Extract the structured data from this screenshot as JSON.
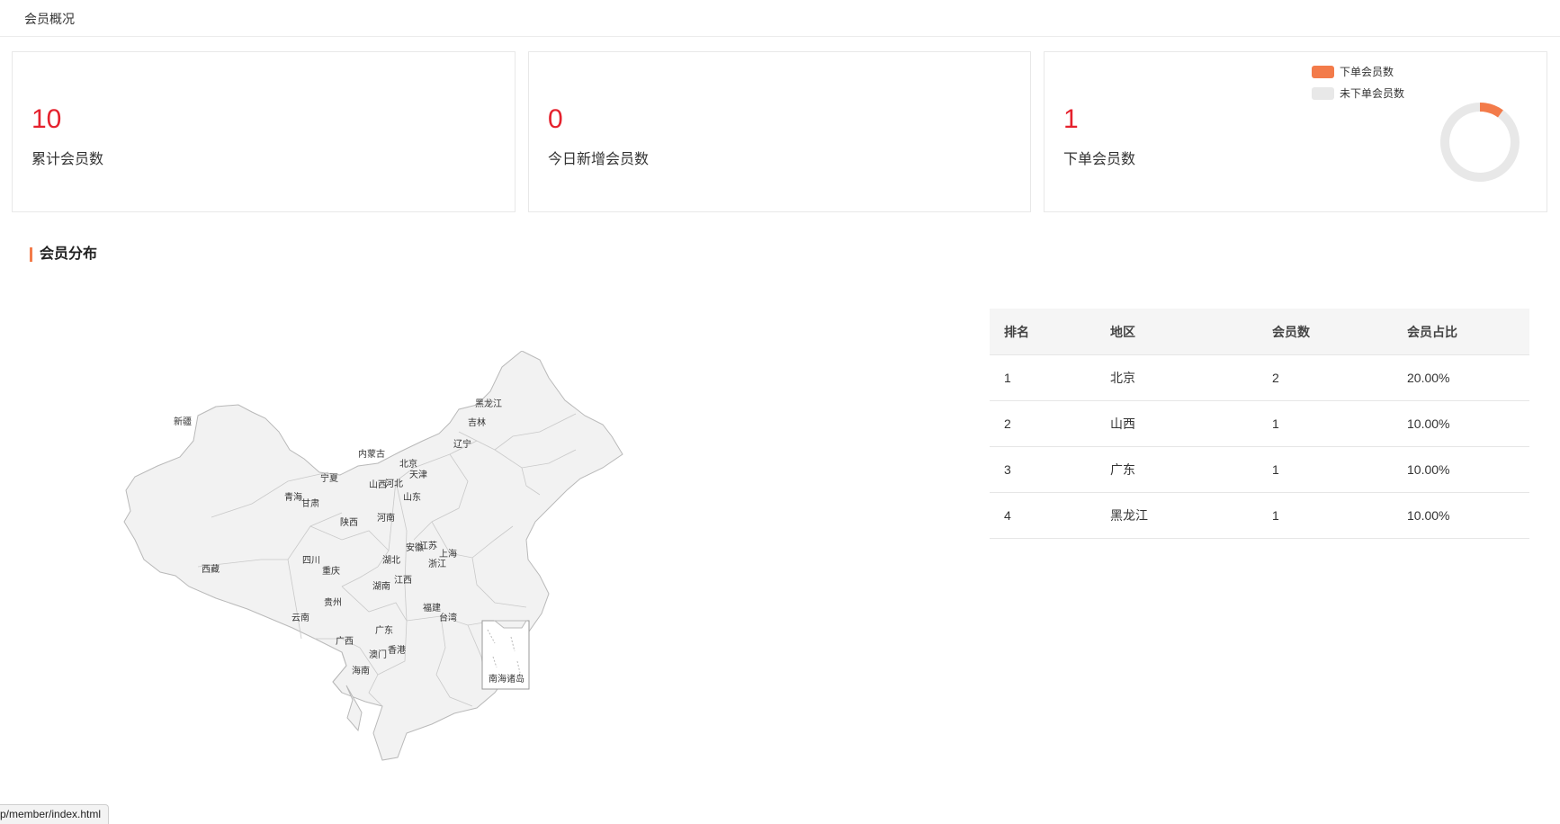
{
  "header": {
    "title": "会员概况"
  },
  "cards": [
    {
      "value": "10",
      "label": "累计会员数"
    },
    {
      "value": "0",
      "label": "今日新增会员数"
    },
    {
      "value": "1",
      "label": "下单会员数"
    }
  ],
  "legend": {
    "ordered": {
      "label": "下单会员数",
      "color": "#f37b4a"
    },
    "not_ordered": {
      "label": "未下单会员数",
      "color": "#e8e8e8"
    }
  },
  "section": {
    "title": "会员分布"
  },
  "map": {
    "provinces": [
      "新疆",
      "西藏",
      "青海",
      "甘肃",
      "宁夏",
      "内蒙古",
      "黑龙江",
      "吉林",
      "辽宁",
      "北京",
      "天津",
      "河北",
      "山西",
      "山东",
      "陕西",
      "河南",
      "江苏",
      "安徽",
      "上海",
      "浙江",
      "湖北",
      "四川",
      "重庆",
      "湖南",
      "江西",
      "贵州",
      "云南",
      "福建",
      "台湾",
      "广西",
      "广东",
      "澳门",
      "香港",
      "海南"
    ],
    "inset_label": "南海诸岛"
  },
  "table": {
    "headers": [
      "排名",
      "地区",
      "会员数",
      "会员占比"
    ],
    "rows": [
      [
        "1",
        "北京",
        "2",
        "20.00%"
      ],
      [
        "2",
        "山西",
        "1",
        "10.00%"
      ],
      [
        "3",
        "广东",
        "1",
        "10.00%"
      ],
      [
        "4",
        "黑龙江",
        "1",
        "10.00%"
      ]
    ]
  },
  "chart_data": {
    "type": "pie",
    "categories": [
      "下单会员数",
      "未下单会员数"
    ],
    "values": [
      1,
      9
    ],
    "title": ""
  },
  "statusbar": {
    "url": "p/member/index.html"
  }
}
